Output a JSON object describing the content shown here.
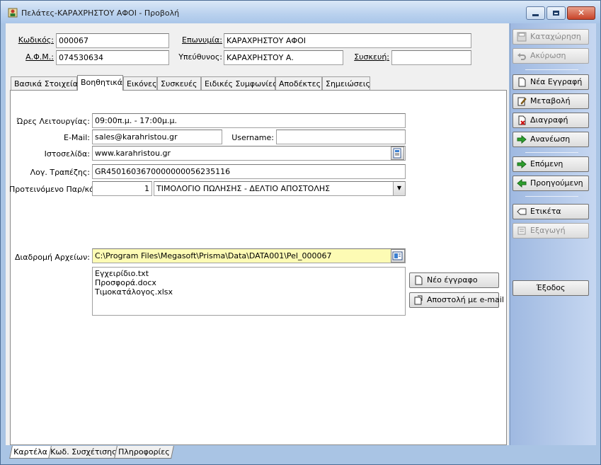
{
  "window": {
    "title": "Πελάτες-ΚΑΡΑΧΡΗΣΤΟΥ ΑΦΟΙ -  Προβολή"
  },
  "header": {
    "code_label": "Κωδικός:",
    "code_value": "000067",
    "name_label": "Επωνυμία:",
    "name_value": "ΚΑΡΑΧΡΗΣΤΟΥ ΑΦΟΙ",
    "afm_label": "Α.Φ.Μ.:",
    "afm_value": "074530634",
    "resp_label": "Υπεύθυνος:",
    "resp_value": "ΚΑΡΑΧΡΗΣΤΟΥ Α.",
    "device_label": "Συσκευή:",
    "device_value": ""
  },
  "tabs": [
    {
      "label": "Βασικά Στοιχεία"
    },
    {
      "label": "Βοηθητικά"
    },
    {
      "label": "Εικόνες"
    },
    {
      "label": "Συσκευές"
    },
    {
      "label": "Ειδικές Συμφωνίες"
    },
    {
      "label": "Αποδέκτες"
    },
    {
      "label": "Σημειώσεις"
    }
  ],
  "form": {
    "hours_label": "Ώρες Λειτουργίας:",
    "hours_value": "09:00π.μ. - 17:00μ.μ.",
    "email_label": "E-Mail:",
    "email_value": "sales@karahristou.gr",
    "username_label": "Username:",
    "username_value": "",
    "website_label": "Ιστοσελίδα:",
    "website_value": "www.karahristou.gr",
    "bank_label": "Λογ. Τραπέζης:",
    "bank_value": "GR4501603670000000056235116",
    "doc_label": "Προτεινόμενο Παρ/κό:",
    "doc_num": "1",
    "doc_value": "ΤΙΜΟΛΟΓΙΟ ΠΩΛΗΣΗΣ - ΔΕΛΤΙΟ ΑΠΟΣΤΟΛΗΣ",
    "path_label": "Διαδρομή Αρχείων:",
    "path_value": "C:\\Program Files\\Megasoft\\Prisma\\Data\\DATA001\\Pel_000067",
    "files": [
      "Εγχειρίδιο.txt",
      "Προσφορά.docx",
      "Τιμοκατάλογος.xlsx"
    ],
    "new_doc_button": "Νέο έγγραφο",
    "send_email_button": "Αποστολή με e-mail"
  },
  "sidebar": {
    "save": "Καταχώρηση",
    "cancel": "Ακύρωση",
    "new": "Νέα Εγγραφή",
    "edit": "Μεταβολή",
    "delete": "Διαγραφή",
    "refresh": "Ανανέωση",
    "next": "Επόμενη",
    "prev": "Προηγούμενη",
    "label": "Ετικέτα",
    "export": "Εξαγωγή",
    "exit": "Έξοδος"
  },
  "bottom_tabs": [
    {
      "label": "Καρτέλα"
    },
    {
      "label": "Κωδ. Συσχέτισης"
    },
    {
      "label": "Πληροφορίες"
    }
  ]
}
